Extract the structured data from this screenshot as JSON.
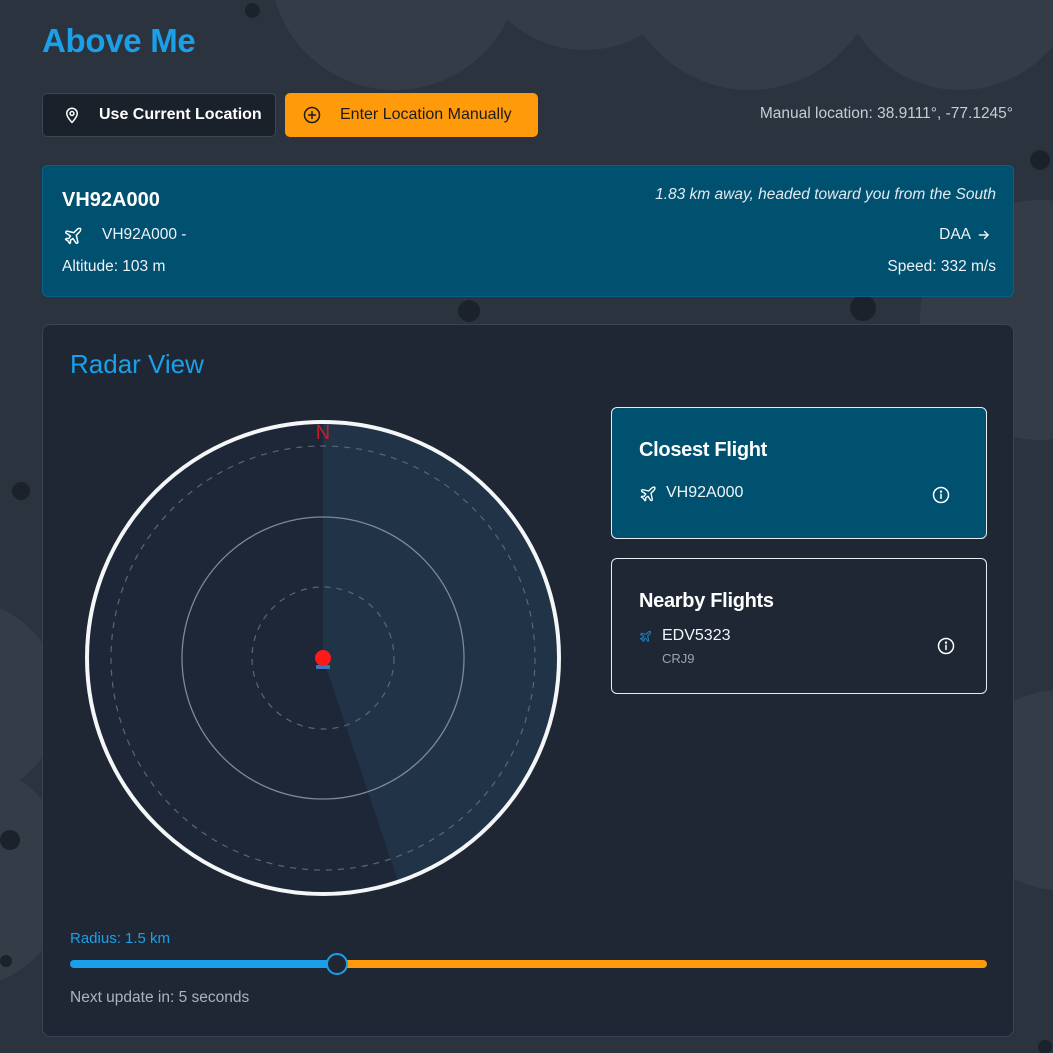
{
  "app": {
    "title": "Above Me"
  },
  "location_controls": {
    "use_current_label": "Use Current Location",
    "use_current_icon": "map-pin-icon",
    "manual_label": "Enter Location Manually",
    "manual_icon": "plus-circle-icon",
    "manual_location_text": "Manual location: 38.9111°, -77.1245°"
  },
  "flight_banner": {
    "callsign": "VH92A000",
    "distance_text": "1.83 km away, headed toward you from the South",
    "route_text": "VH92A000 -",
    "destination": "DAA",
    "altitude_text": "Altitude: 103 m",
    "speed_text": "Speed: 332 m/s",
    "icon": "plane-icon"
  },
  "radar": {
    "title": "Radar View",
    "north_label": "N",
    "closest_card": {
      "title": "Closest Flight",
      "flight": "VH92A000",
      "icon": "plane-icon"
    },
    "nearby_card": {
      "title": "Nearby Flights",
      "flights": [
        {
          "callsign": "EDV5323",
          "aircraft": "CRJ9"
        }
      ]
    },
    "radius_text": "Radius: 1.5 km",
    "slider_fraction": 0.291,
    "next_update_text": "Next update in: 5 seconds"
  },
  "colors": {
    "accent_blue": "#1aa0e8",
    "accent_orange": "#ff9a0a",
    "banner_teal": "#00506f",
    "panel_bg": "#1f2735",
    "page_bg": "#2b333e",
    "user_dot": "#ff1a1a",
    "north_red": "#c81d25"
  }
}
